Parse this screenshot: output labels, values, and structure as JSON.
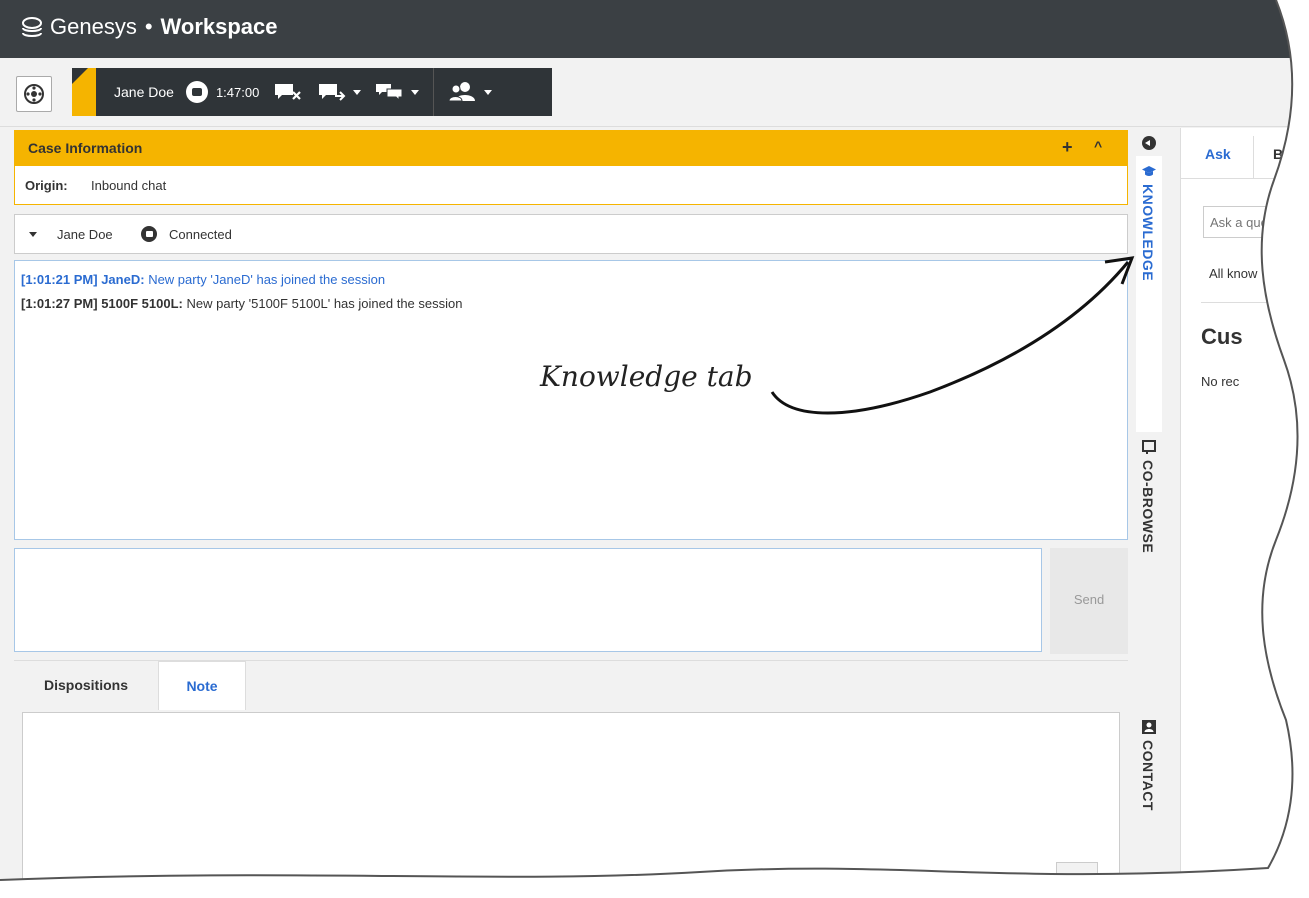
{
  "app": {
    "brand": "Genesys",
    "separator": "•",
    "product": "Workspace"
  },
  "interaction_bar": {
    "contact_name": "Jane Doe",
    "timer": "1:47:00"
  },
  "case_information": {
    "title": "Case Information",
    "expand_label": "+",
    "collapse_label": "^",
    "origin_label": "Origin:",
    "origin_value": "Inbound chat"
  },
  "party": {
    "name": "Jane Doe",
    "status": "Connected"
  },
  "transcript": [
    {
      "time": "[1:01:21 PM]",
      "sender": "JaneD:",
      "text": "New party 'JaneD' has joined the session"
    },
    {
      "time": "[1:01:27 PM]",
      "sender": "5100F 5100L:",
      "text": "New party '5100F 5100L' has joined the session"
    }
  ],
  "compose": {
    "send_label": "Send"
  },
  "bottom_tabs": {
    "dispositions": "Dispositions",
    "note": "Note"
  },
  "side_rail": {
    "knowledge": "KNOWLEDGE",
    "cobrowse": "CO-BROWSE",
    "contact": "CONTACT"
  },
  "knowledge_panel": {
    "tab_ask": "Ask",
    "tab_browse": "B",
    "ask_placeholder": "Ask a que",
    "filter_text": "All know",
    "heading": "Cus",
    "empty_text": "No rec"
  },
  "annotation": {
    "text": "Knowledge tab"
  },
  "colors": {
    "header_bg": "#3b4044",
    "accent_yellow": "#f5b400",
    "link_blue": "#2a6bd1"
  }
}
